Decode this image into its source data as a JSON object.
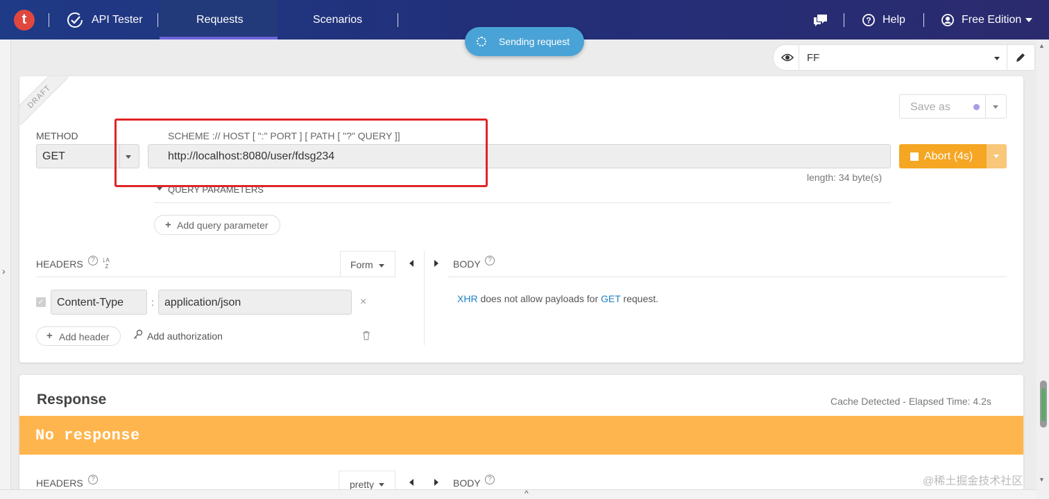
{
  "header": {
    "logo_letter": "t",
    "app_name": "API Tester",
    "tabs": [
      {
        "label": "Requests",
        "active": true
      },
      {
        "label": "Scenarios",
        "active": false
      }
    ],
    "help_label": "Help",
    "edition_label": "Free Edition"
  },
  "status_pill": {
    "label": "Sending request"
  },
  "environment": {
    "selected": "FF"
  },
  "request": {
    "ribbon": "DRAFT",
    "save_as_label": "Save as",
    "method_label": "METHOD",
    "method_value": "GET",
    "url_hint": "SCHEME :// HOST [ \":\" PORT ] [ PATH [ \"?\" QUERY ]]",
    "url_value": "http://localhost:8080/user/fdsg234",
    "length_text": "length: 34 byte(s)",
    "abort_label": "Abort (4s)",
    "query_params_label": "QUERY PARAMETERS",
    "add_query_param_label": "Add query parameter",
    "headers_label": "HEADERS",
    "form_label": "Form",
    "body_label": "BODY",
    "header_rows": [
      {
        "name": "Content-Type",
        "value": "application/json",
        "enabled": true
      }
    ],
    "add_header_label": "Add header",
    "add_authorization_label": "Add authorization",
    "body_message": {
      "xhr": "XHR",
      "middle": " does not allow payloads for ",
      "method": "GET",
      "end": " request."
    }
  },
  "response": {
    "title": "Response",
    "meta": "Cache Detected - Elapsed Time: 4.2s",
    "banner": "No response",
    "headers_label": "HEADERS",
    "pretty_label": "pretty",
    "body_label": "BODY"
  },
  "watermark": "@稀土掘金技术社区",
  "colors": {
    "accent_orange": "#f5a623",
    "banner_orange": "#ffb54d",
    "pill_blue": "#4aa3d6",
    "nav_dark": "#22307a",
    "highlight_red": "#e02424"
  }
}
